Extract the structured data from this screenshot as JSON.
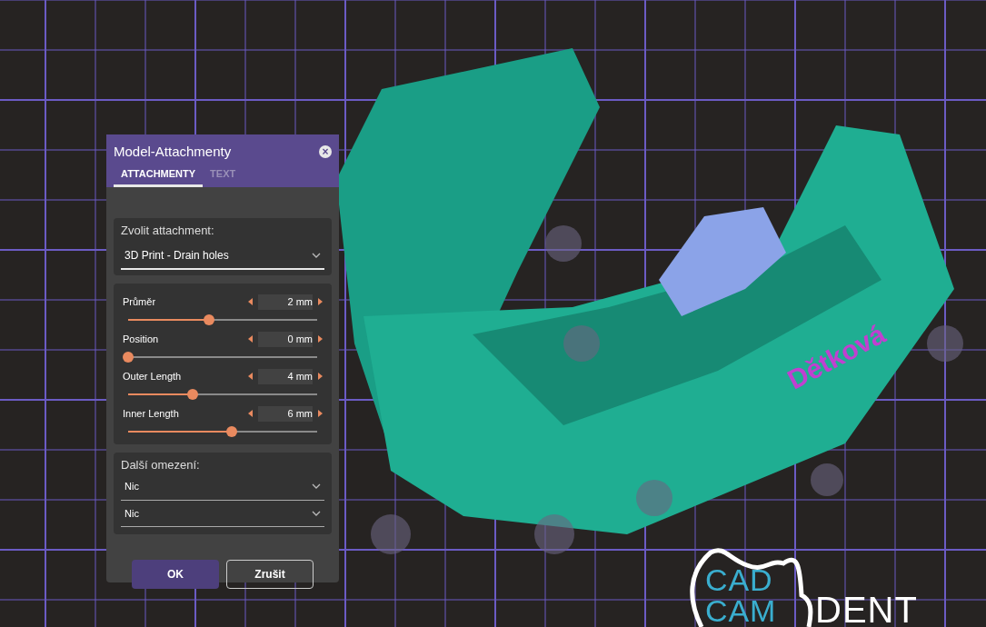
{
  "dialog": {
    "title": "Model-Attachmenty",
    "close_icon": "×",
    "tabs": [
      {
        "label": "ATTACHMENTY",
        "selected": true
      },
      {
        "label": "TEXT",
        "selected": false
      }
    ],
    "attachment": {
      "label": "Zvolit attachment:",
      "value": "3D Print - Drain holes"
    },
    "parameters": [
      {
        "name": "Průměr",
        "value": "2 mm",
        "level": 0.43
      },
      {
        "name": "Position",
        "value": "0 mm",
        "level": 0
      },
      {
        "name": "Outer Length",
        "value": "4 mm",
        "level": 0.34
      },
      {
        "name": "Inner Length",
        "value": "6 mm",
        "level": 0.55
      }
    ],
    "constraints": {
      "label": "Další omezení:",
      "selects": [
        "Nic",
        "Nic"
      ]
    },
    "buttons": [
      {
        "label": "OK",
        "kind": "primary"
      },
      {
        "label": "Zrušit",
        "kind": "secondary"
      }
    ]
  },
  "model_label": "Dětková",
  "logo": {
    "line_1": "CAD",
    "line_2": "CAM",
    "word": "DENT"
  }
}
